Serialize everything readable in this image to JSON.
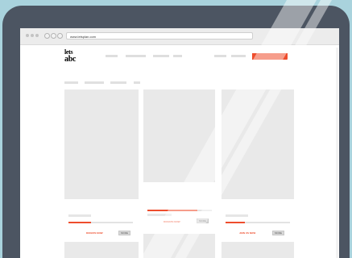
{
  "browser": {
    "url": "www.letsplan.com"
  },
  "colors": {
    "background": "#a9d3dd",
    "tablet_frame": "#4c5562",
    "accent": "#ee4d2d"
  },
  "cards": [
    {
      "cta_label": "DONATE NOW",
      "button_label": "MORE",
      "progress": 0.35
    },
    {
      "cta_label": "DONATE NOW",
      "button_label": "MORE",
      "progress": 0.78
    },
    {
      "cta_label": "JOIN US NOW",
      "button_label": "MORE",
      "progress": 0.3
    }
  ]
}
